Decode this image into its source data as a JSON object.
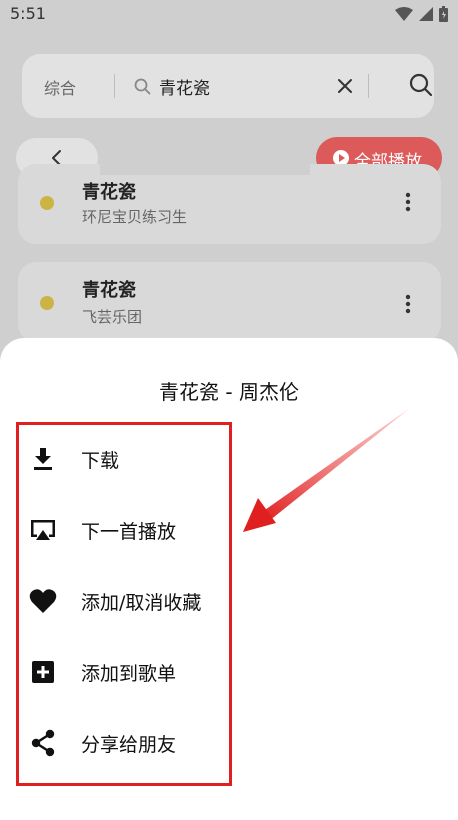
{
  "status_bar": {
    "time": "5:51"
  },
  "search": {
    "category": "综合",
    "query": "青花瓷"
  },
  "toolbar": {
    "play_all_label": "全部播放"
  },
  "results": [
    {
      "title": "青花瓷",
      "artist": "环尼宝贝练习生"
    },
    {
      "title": "青花瓷",
      "artist": "飞芸乐团"
    }
  ],
  "sheet": {
    "title": "青花瓷 - 周杰伦",
    "items": [
      {
        "label": "下载",
        "icon": "download-icon"
      },
      {
        "label": "下一首播放",
        "icon": "cast-icon"
      },
      {
        "label": "添加/取消收藏",
        "icon": "heart-icon"
      },
      {
        "label": "添加到歌单",
        "icon": "add-to-playlist-icon"
      },
      {
        "label": "分享给朋友",
        "icon": "share-icon"
      }
    ]
  },
  "colors": {
    "accent": "#dc5a5a",
    "annotation": "#e02020",
    "dot": "#cbb443"
  }
}
